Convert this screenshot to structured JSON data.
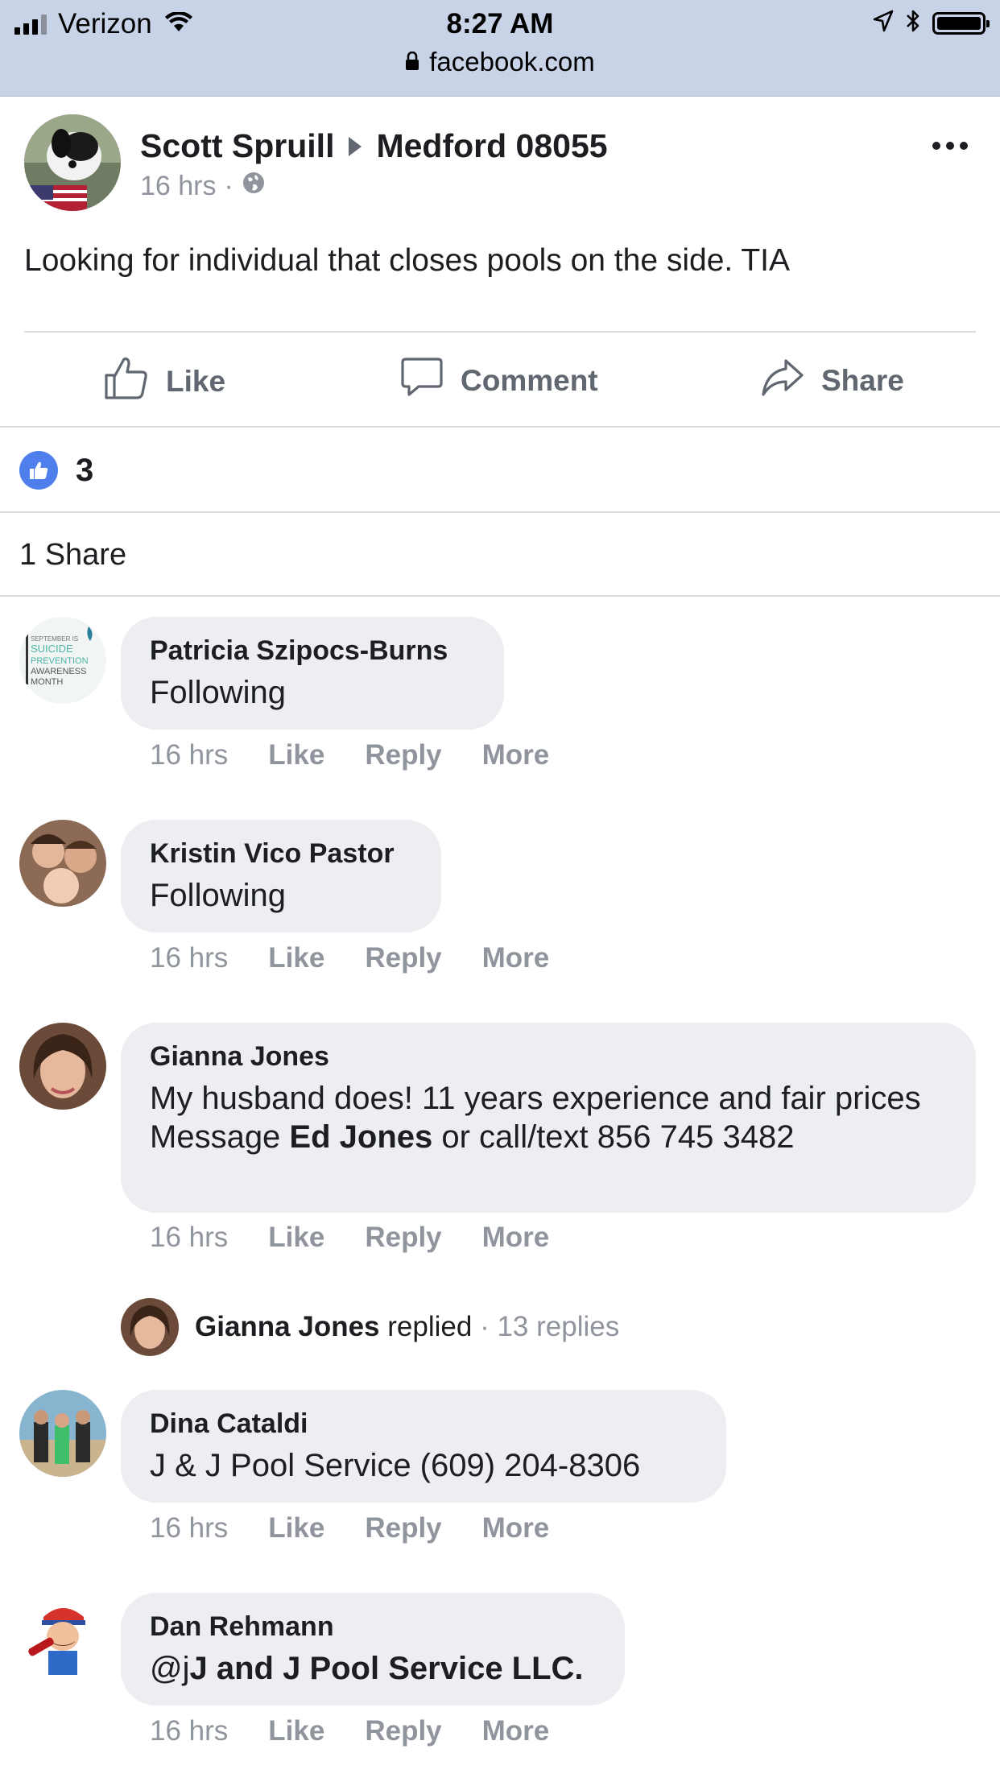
{
  "status_bar": {
    "carrier": "Verizon",
    "time": "8:27 AM",
    "url": "facebook.com"
  },
  "post": {
    "author": "Scott Spruill",
    "group": "Medford 08055",
    "time": "16 hrs",
    "separator": "·",
    "privacy_icon": "globe-icon",
    "text": "Looking for individual that closes pools on the side. TIA"
  },
  "actions": {
    "like": "Like",
    "comment": "Comment",
    "share": "Share"
  },
  "reactions": {
    "count": "3",
    "shares": "1 Share"
  },
  "comments": [
    {
      "name": "Patricia Szipocs-Burns",
      "text": "Following",
      "avatar_lines": [
        "SEPTEMBER IS",
        "SUICIDE",
        "PREVENTION",
        "AWARENESS",
        "MONTH"
      ],
      "time": "16 hrs",
      "like": "Like",
      "reply": "Reply",
      "more": "More"
    },
    {
      "name": "Kristin Vico Pastor",
      "text": "Following",
      "time": "16 hrs",
      "like": "Like",
      "reply": "Reply",
      "more": "More"
    },
    {
      "name": "Gianna Jones",
      "text_line1": "My husband does! 11 years experience and fair prices",
      "text_pre": "Message ",
      "text_bold": "Ed Jones",
      "text_post": " or call/text 856 745 3482",
      "time": "16 hrs",
      "like": "Like",
      "reply": "Reply",
      "more": "More"
    },
    {
      "name": "Dina Cataldi",
      "text": "J & J Pool Service (609) 204-8306",
      "time": "16 hrs",
      "like": "Like",
      "reply": "Reply",
      "more": "More"
    },
    {
      "name": "Dan Rehmann",
      "text_pre": "@j",
      "text_bold": "J and J Pool Service LLC.",
      "time": "16 hrs",
      "like": "Like",
      "reply": "Reply",
      "more": "More"
    }
  ],
  "reply_summary": {
    "name": "Gianna Jones",
    "action": "replied",
    "count": "· 13 replies"
  },
  "colors": {
    "status_bar_bg": "#c9d3e8",
    "bubble_bg": "#eceef2",
    "like_blue": "#4e7fed",
    "meta_gray": "#90949c"
  }
}
